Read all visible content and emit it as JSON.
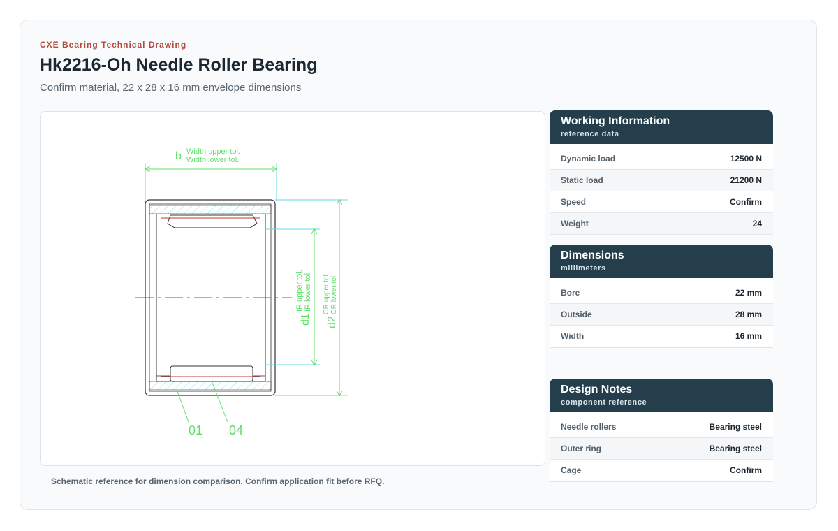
{
  "header": {
    "eyebrow": "CXE Bearing Technical Drawing",
    "title": "Hk2216-Oh Needle Roller Bearing",
    "subtitle": "Confirm material, 22 x 28 x 16 mm envelope dimensions"
  },
  "drawing": {
    "label_b": "b",
    "width_upper": "Width upper tol.",
    "width_lower": "Width lower tol.",
    "label_d1": "d1",
    "ir_upper": "IR upper tol.",
    "ir_lower": "IR lower tol.",
    "label_d2": "d2",
    "or_upper": "OR upper tol.",
    "or_lower": "OR lower tol.",
    "part_01": "01",
    "part_04": "04",
    "colors": {
      "dimension": "#5fe06a",
      "centerline": "#c0392b",
      "extension": "#66d9e8",
      "outline": "#333333"
    }
  },
  "caption": "Schematic reference for dimension comparison. Confirm application fit before RFQ.",
  "panels": [
    {
      "title": "Working Information",
      "subtitle": "reference data",
      "rows": [
        {
          "label": "Dynamic load",
          "value": "12500 N"
        },
        {
          "label": "Static load",
          "value": "21200 N"
        },
        {
          "label": "Speed",
          "value": "Confirm"
        },
        {
          "label": "Weight",
          "value": "24"
        }
      ]
    },
    {
      "title": "Dimensions",
      "subtitle": "millimeters",
      "rows": [
        {
          "label": "Bore",
          "value": "22 mm"
        },
        {
          "label": "Outside",
          "value": "28 mm"
        },
        {
          "label": "Width",
          "value": "16 mm"
        }
      ]
    },
    {
      "title": "Design Notes",
      "subtitle": "component reference",
      "rows": [
        {
          "label": "Needle rollers",
          "value": "Bearing steel"
        },
        {
          "label": "Outer ring",
          "value": "Bearing steel"
        },
        {
          "label": "Cage",
          "value": "Confirm"
        }
      ]
    }
  ]
}
